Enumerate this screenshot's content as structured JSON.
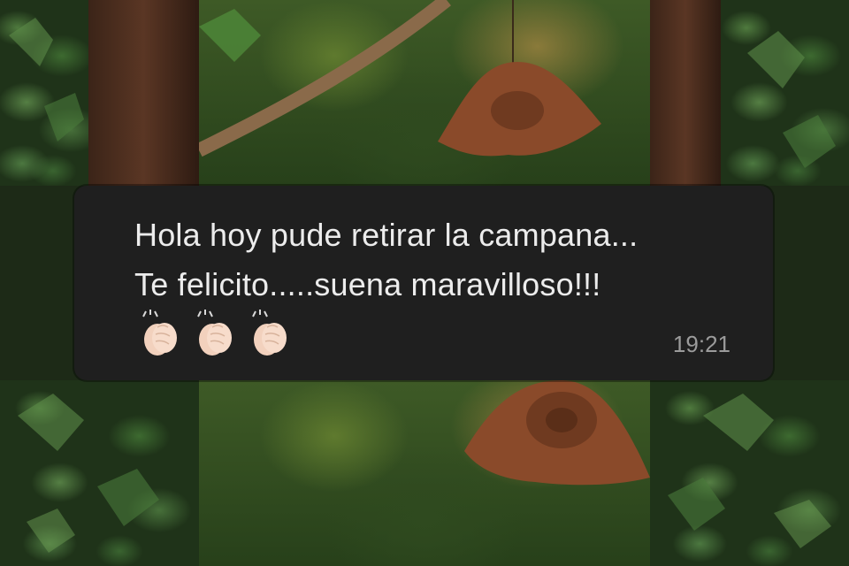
{
  "message": {
    "line1": "Hola hoy pude retirar la campana...",
    "line2": "Te felicito.....suena maravilloso!!!",
    "emojis": [
      "clapping-hands-icon",
      "clapping-hands-icon",
      "clapping-hands-icon"
    ],
    "time": "19:21"
  },
  "colors": {
    "bubble": "#1f1f1f",
    "text": "#ececec",
    "timestamp": "#9b9b9b",
    "ivy": "#3d6a30",
    "bell": "#8a4a2a"
  }
}
